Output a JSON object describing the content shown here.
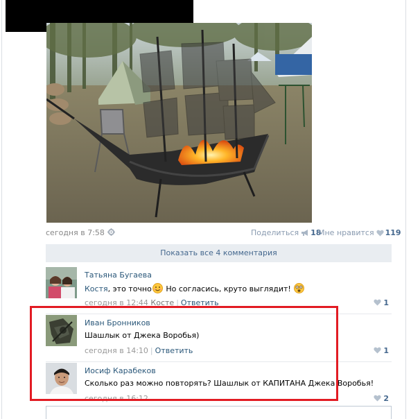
{
  "post": {
    "time": "сегодня в 7:58",
    "share_label": "Поделиться",
    "share_count": "18",
    "like_label": "Мне нравится",
    "like_count": "119"
  },
  "comments_toggle": {
    "label": "Показать все 4 комментария"
  },
  "comments": [
    {
      "author": "Татьяна Бугаева",
      "text_mention": "Костя",
      "text_part1": ", это точно",
      "text_part2": " Но согласись, круто выглядит!",
      "time": "сегодня в 12:44",
      "reply_to": "Косте",
      "reply_label": "Ответить",
      "likes": "1"
    },
    {
      "author": "Иван Бронников",
      "text": "Шашлык от Джека Воробья)",
      "time": "сегодня в 14:10",
      "reply_label": "Ответить",
      "likes": "1"
    },
    {
      "author": "Иосиф Карабеков",
      "text": "Сколько раз можно повторять? Шашлык от КАПИТАНА Джека Воробья!",
      "time": "сегодня в 16:12",
      "likes": "2"
    }
  ],
  "icons": {
    "settings": "gear-icon",
    "share": "megaphone-icon",
    "like": "heart-icon",
    "smile": "smiley-emoji",
    "shocked": "shocked-emoji"
  },
  "colors": {
    "link": "#2b587a",
    "accent": "#45688e",
    "highlight": "#e21b23",
    "button_bg": "#e9edf1"
  }
}
